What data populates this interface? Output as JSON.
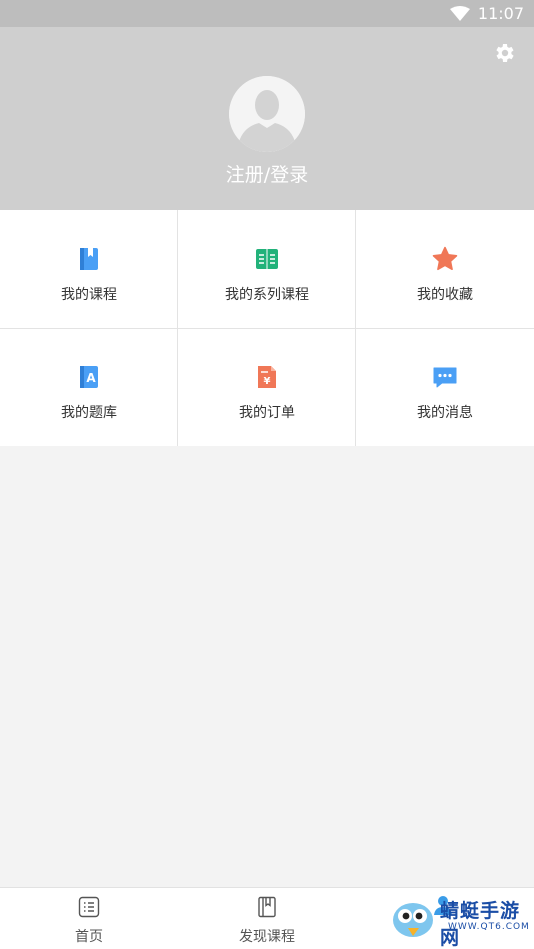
{
  "status_bar": {
    "time": "11:07"
  },
  "header": {
    "login_label": "注册/登录"
  },
  "menu": {
    "items": [
      {
        "label": "我的课程",
        "icon": "book-icon",
        "color": "#4a9ff5"
      },
      {
        "label": "我的系列课程",
        "icon": "open-book-icon",
        "color": "#22b27a"
      },
      {
        "label": "我的收藏",
        "icon": "star-icon",
        "color": "#f07757"
      },
      {
        "label": "我的题库",
        "icon": "question-bank-icon",
        "color": "#4a9ff5"
      },
      {
        "label": "我的订单",
        "icon": "order-icon",
        "color": "#f07757"
      },
      {
        "label": "我的消息",
        "icon": "message-icon",
        "color": "#4a9ff5"
      }
    ]
  },
  "tabbar": {
    "tabs": [
      {
        "label": "首页",
        "icon": "home-list-icon"
      },
      {
        "label": "发现课程",
        "icon": "discover-book-icon"
      }
    ]
  },
  "watermark": {
    "text": "蜻蜓手游网",
    "url": "WWW.QT6.COM"
  }
}
